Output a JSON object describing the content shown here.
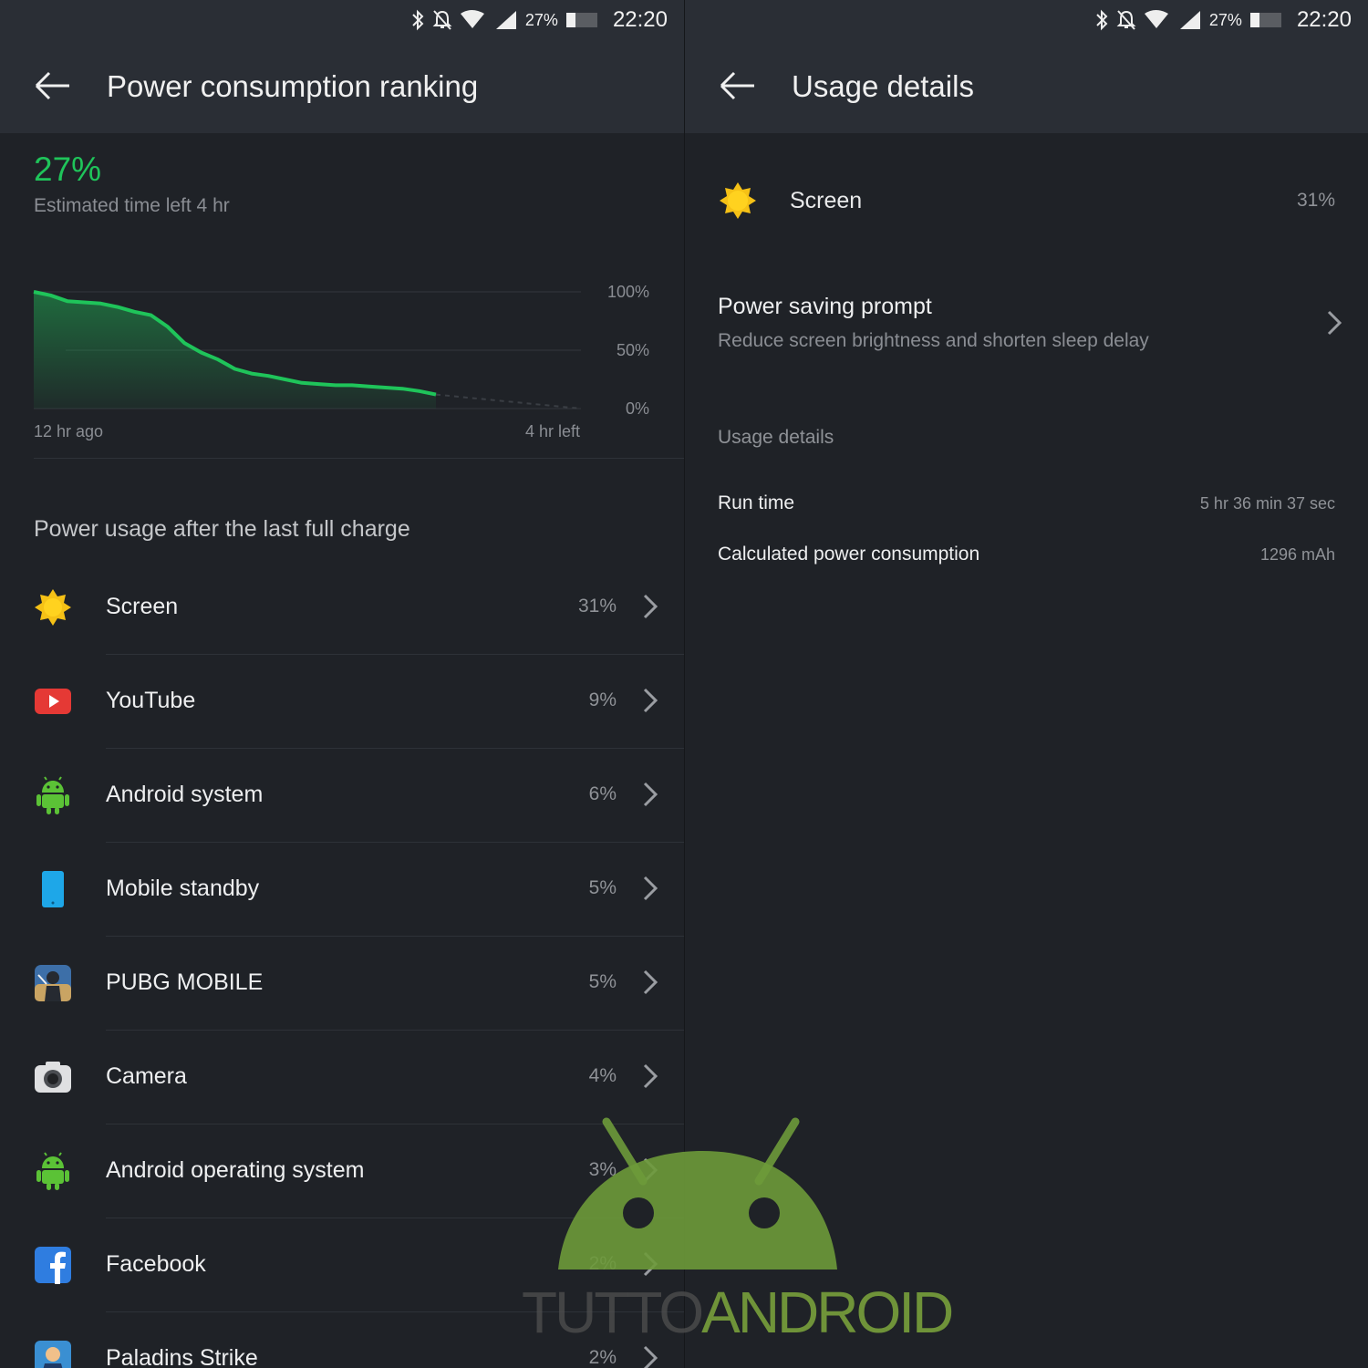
{
  "status": {
    "battery": "27%",
    "time": "22:20"
  },
  "left": {
    "title": "Power consumption ranking",
    "battery_percent": "27%",
    "estimated": "Estimated time left 4 hr",
    "chart_data": {
      "type": "area",
      "x_labels": [
        "12 hr ago",
        "4 hr left"
      ],
      "y_ticks": [
        "100%",
        "50%",
        "0%"
      ],
      "ylim": [
        0,
        100
      ],
      "x": [
        0,
        0.5,
        1,
        1.5,
        2,
        2.5,
        3,
        3.5,
        4,
        4.5,
        5,
        5.5,
        6,
        6.5,
        7,
        7.5,
        8,
        8.5,
        9,
        9.5,
        10,
        10.5,
        11,
        11.5,
        12
      ],
      "values": [
        100,
        97,
        92,
        91,
        90,
        87,
        83,
        80,
        70,
        56,
        48,
        42,
        34,
        30,
        28,
        25,
        22,
        21,
        20,
        20,
        19,
        18,
        17,
        15,
        12
      ],
      "projection": {
        "from_value": 12,
        "to_value": 0
      },
      "color": "#1fc45a"
    },
    "section_title": "Power usage after the last full charge",
    "items": [
      {
        "label": "Screen",
        "value": "31%",
        "icon": "sun-icon"
      },
      {
        "label": "YouTube",
        "value": "9%",
        "icon": "youtube-icon"
      },
      {
        "label": "Android system",
        "value": "6%",
        "icon": "android-icon"
      },
      {
        "label": "Mobile standby",
        "value": "5%",
        "icon": "phone-icon"
      },
      {
        "label": "PUBG MOBILE",
        "value": "5%",
        "icon": "pubg-icon"
      },
      {
        "label": "Camera",
        "value": "4%",
        "icon": "camera-icon"
      },
      {
        "label": "Android operating system",
        "value": "3%",
        "icon": "android-icon"
      },
      {
        "label": "Facebook",
        "value": "2%",
        "icon": "facebook-icon"
      },
      {
        "label": "Paladins Strike",
        "value": "2%",
        "icon": "paladins-icon"
      }
    ]
  },
  "right": {
    "title": "Usage details",
    "item": {
      "label": "Screen",
      "value": "31%",
      "icon": "sun-icon"
    },
    "prompt": {
      "title": "Power saving prompt",
      "subtitle": "Reduce screen brightness and shorten sleep delay"
    },
    "details_title": "Usage details",
    "details": [
      {
        "key": "Run time",
        "value": "5 hr 36 min 37 sec"
      },
      {
        "key": "Calculated power consumption",
        "value": "1296 mAh"
      }
    ]
  },
  "watermark": {
    "part1": "TUTTO",
    "part2": "ANDROID"
  },
  "colors": {
    "accent": "#1fc45a",
    "background": "#1f2227",
    "appbar": "#2a2e35"
  }
}
